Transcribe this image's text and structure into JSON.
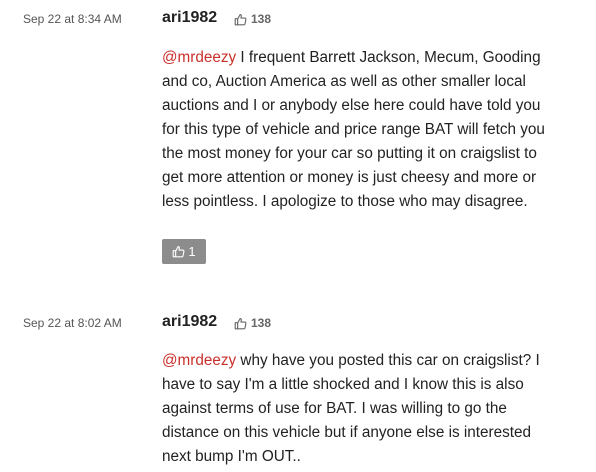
{
  "comments": [
    {
      "date": "Sep 22 at 8:34 AM",
      "author": "ari1982",
      "reputation": "138",
      "mention": "@mrdeezy",
      "lines": [
        " I frequent Barrett Jackson, Mecum, Gooding",
        "and co, Auction America as well as other smaller local",
        "auctions and I or anybody else here could have told you",
        "for this type of vehicle and price range BAT will fetch you",
        "the most money for your car so putting it on craigslist to",
        "get more attention or money is just cheesy and more or",
        "less pointless. I apologize to those who may disagree."
      ],
      "likes": "1"
    },
    {
      "date": "Sep 22 at 8:02 AM",
      "author": "ari1982",
      "reputation": "138",
      "mention": "@mrdeezy",
      "lines": [
        " why have you posted this car on craigslist? I",
        "have to say I'm a little shocked and I know this is also",
        "against terms of use for BAT. I was willing to go the",
        "distance on this vehicle but if anyone else is interested",
        "next bump I'm OUT.."
      ]
    }
  ],
  "icons": {
    "reputation": "thumbs-up-outline-icon",
    "like": "thumbs-up-outline-icon"
  },
  "colors": {
    "mention": "#c9302c",
    "like_button_bg": "#8c8c8c"
  }
}
